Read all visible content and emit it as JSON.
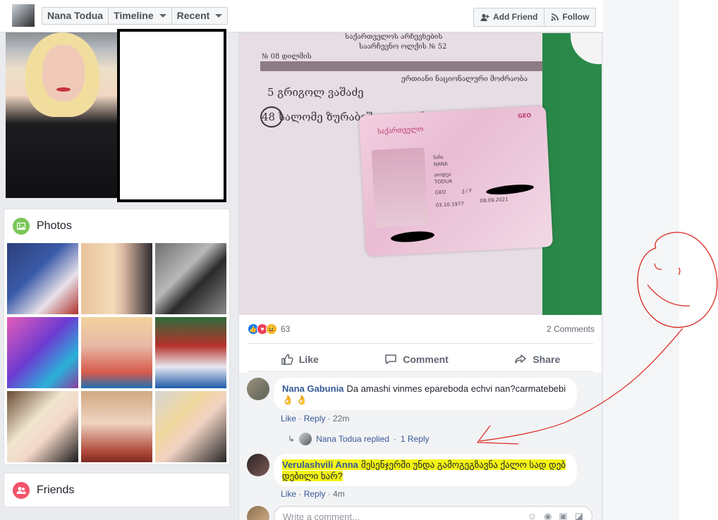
{
  "header": {
    "name_tab": "Nana Todua",
    "timeline_tab": "Timeline",
    "recent_tab": "Recent",
    "add_friend": "Add Friend",
    "follow": "Follow"
  },
  "photos_card": {
    "title": "Photos"
  },
  "friends_card": {
    "title": "Friends"
  },
  "post_image": {
    "doc_lines": [
      "საქართველოს არჩევნების",
      "საარჩევნო ოლქის № 52",
      "№ 08 დილმის",
      "ერთიანი ნაციონალური მოძრაობა",
      "5  გრიგოლ ვაშაძე",
      "48  სალომე ზურაბიშვილი  დამოუკიდებელი"
    ],
    "card_country": "საქართველო",
    "card_first_name": "ნანა\nNANA",
    "card_last_name": "თოდუა\nTODUA",
    "card_sex": "ქ / F",
    "card_nationality": "GEO",
    "card_birth": "03.10.1977",
    "card_expiry": "08.09.2021",
    "card_code": "GEO"
  },
  "reactions": {
    "count": "63",
    "comments": "2 Comments"
  },
  "actions": {
    "like": "Like",
    "comment": "Comment",
    "share": "Share"
  },
  "comments": [
    {
      "name": "Nana Gabunia",
      "text": "Da amashi vinmes epareboda echvi nan?carmatebebi",
      "emoji": "👌 👌",
      "like": "Like",
      "reply": "Reply",
      "time": "22m"
    },
    {
      "name": "Verulashvili Anna",
      "text": "მესენჯერში უნდა გამოგეგზავნა ქალო სად დებ დებილი ხარ?",
      "like": "Like",
      "reply": "Reply",
      "time": "4m"
    }
  ],
  "reply_summary": {
    "text": "Nana Todua replied",
    "count": "1 Reply"
  },
  "write_comment": {
    "placeholder": "Write a comment..."
  },
  "colors": {
    "fb_blue": "#385898",
    "highlight": "#f3f315",
    "annotation_red": "#d9261c"
  }
}
